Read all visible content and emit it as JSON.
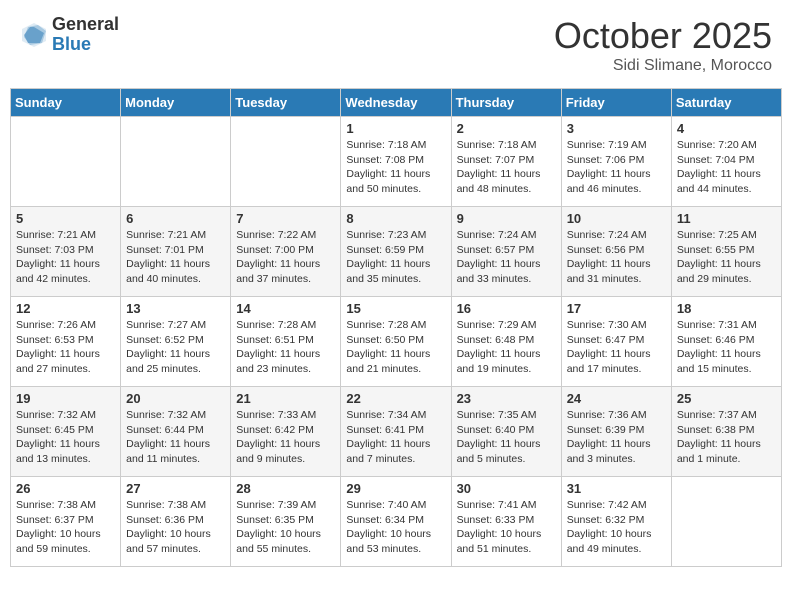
{
  "header": {
    "logo_general": "General",
    "logo_blue": "Blue",
    "month": "October 2025",
    "location": "Sidi Slimane, Morocco"
  },
  "days_of_week": [
    "Sunday",
    "Monday",
    "Tuesday",
    "Wednesday",
    "Thursday",
    "Friday",
    "Saturday"
  ],
  "weeks": [
    [
      {
        "day": "",
        "content": ""
      },
      {
        "day": "",
        "content": ""
      },
      {
        "day": "",
        "content": ""
      },
      {
        "day": "1",
        "content": "Sunrise: 7:18 AM\nSunset: 7:08 PM\nDaylight: 11 hours and 50 minutes."
      },
      {
        "day": "2",
        "content": "Sunrise: 7:18 AM\nSunset: 7:07 PM\nDaylight: 11 hours and 48 minutes."
      },
      {
        "day": "3",
        "content": "Sunrise: 7:19 AM\nSunset: 7:06 PM\nDaylight: 11 hours and 46 minutes."
      },
      {
        "day": "4",
        "content": "Sunrise: 7:20 AM\nSunset: 7:04 PM\nDaylight: 11 hours and 44 minutes."
      }
    ],
    [
      {
        "day": "5",
        "content": "Sunrise: 7:21 AM\nSunset: 7:03 PM\nDaylight: 11 hours and 42 minutes."
      },
      {
        "day": "6",
        "content": "Sunrise: 7:21 AM\nSunset: 7:01 PM\nDaylight: 11 hours and 40 minutes."
      },
      {
        "day": "7",
        "content": "Sunrise: 7:22 AM\nSunset: 7:00 PM\nDaylight: 11 hours and 37 minutes."
      },
      {
        "day": "8",
        "content": "Sunrise: 7:23 AM\nSunset: 6:59 PM\nDaylight: 11 hours and 35 minutes."
      },
      {
        "day": "9",
        "content": "Sunrise: 7:24 AM\nSunset: 6:57 PM\nDaylight: 11 hours and 33 minutes."
      },
      {
        "day": "10",
        "content": "Sunrise: 7:24 AM\nSunset: 6:56 PM\nDaylight: 11 hours and 31 minutes."
      },
      {
        "day": "11",
        "content": "Sunrise: 7:25 AM\nSunset: 6:55 PM\nDaylight: 11 hours and 29 minutes."
      }
    ],
    [
      {
        "day": "12",
        "content": "Sunrise: 7:26 AM\nSunset: 6:53 PM\nDaylight: 11 hours and 27 minutes."
      },
      {
        "day": "13",
        "content": "Sunrise: 7:27 AM\nSunset: 6:52 PM\nDaylight: 11 hours and 25 minutes."
      },
      {
        "day": "14",
        "content": "Sunrise: 7:28 AM\nSunset: 6:51 PM\nDaylight: 11 hours and 23 minutes."
      },
      {
        "day": "15",
        "content": "Sunrise: 7:28 AM\nSunset: 6:50 PM\nDaylight: 11 hours and 21 minutes."
      },
      {
        "day": "16",
        "content": "Sunrise: 7:29 AM\nSunset: 6:48 PM\nDaylight: 11 hours and 19 minutes."
      },
      {
        "day": "17",
        "content": "Sunrise: 7:30 AM\nSunset: 6:47 PM\nDaylight: 11 hours and 17 minutes."
      },
      {
        "day": "18",
        "content": "Sunrise: 7:31 AM\nSunset: 6:46 PM\nDaylight: 11 hours and 15 minutes."
      }
    ],
    [
      {
        "day": "19",
        "content": "Sunrise: 7:32 AM\nSunset: 6:45 PM\nDaylight: 11 hours and 13 minutes."
      },
      {
        "day": "20",
        "content": "Sunrise: 7:32 AM\nSunset: 6:44 PM\nDaylight: 11 hours and 11 minutes."
      },
      {
        "day": "21",
        "content": "Sunrise: 7:33 AM\nSunset: 6:42 PM\nDaylight: 11 hours and 9 minutes."
      },
      {
        "day": "22",
        "content": "Sunrise: 7:34 AM\nSunset: 6:41 PM\nDaylight: 11 hours and 7 minutes."
      },
      {
        "day": "23",
        "content": "Sunrise: 7:35 AM\nSunset: 6:40 PM\nDaylight: 11 hours and 5 minutes."
      },
      {
        "day": "24",
        "content": "Sunrise: 7:36 AM\nSunset: 6:39 PM\nDaylight: 11 hours and 3 minutes."
      },
      {
        "day": "25",
        "content": "Sunrise: 7:37 AM\nSunset: 6:38 PM\nDaylight: 11 hours and 1 minute."
      }
    ],
    [
      {
        "day": "26",
        "content": "Sunrise: 7:38 AM\nSunset: 6:37 PM\nDaylight: 10 hours and 59 minutes."
      },
      {
        "day": "27",
        "content": "Sunrise: 7:38 AM\nSunset: 6:36 PM\nDaylight: 10 hours and 57 minutes."
      },
      {
        "day": "28",
        "content": "Sunrise: 7:39 AM\nSunset: 6:35 PM\nDaylight: 10 hours and 55 minutes."
      },
      {
        "day": "29",
        "content": "Sunrise: 7:40 AM\nSunset: 6:34 PM\nDaylight: 10 hours and 53 minutes."
      },
      {
        "day": "30",
        "content": "Sunrise: 7:41 AM\nSunset: 6:33 PM\nDaylight: 10 hours and 51 minutes."
      },
      {
        "day": "31",
        "content": "Sunrise: 7:42 AM\nSunset: 6:32 PM\nDaylight: 10 hours and 49 minutes."
      },
      {
        "day": "",
        "content": ""
      }
    ]
  ]
}
